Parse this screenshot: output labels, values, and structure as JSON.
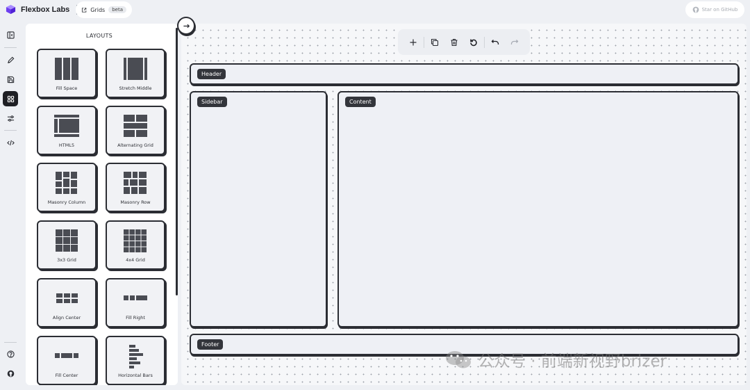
{
  "topbar": {
    "brand": "Flexbox Labs",
    "nav_label": "Grids",
    "nav_badge": "beta",
    "github_label": "Star on GitHub"
  },
  "rail": {
    "items": [
      "toggle-panel-icon",
      "pencil-icon",
      "save-icon",
      "layouts-icon",
      "sliders-icon",
      "code-icon"
    ],
    "bottom": [
      "help-icon",
      "github-icon"
    ],
    "active": "layouts-icon"
  },
  "panel": {
    "title": "LAYOUTS",
    "layouts": [
      "Fill Space",
      "Stretch Middle",
      "HTML5",
      "Alternating Grid",
      "Masonry Column",
      "Masonry Row",
      "3x3 Grid",
      "4x4 Grid",
      "Align Center",
      "Fill Right",
      "Fill Center",
      "Horizontal Bars"
    ]
  },
  "toolbar": {
    "buttons": [
      "plus-icon",
      "copy-icon",
      "trash-icon",
      "reset-icon",
      "undo-icon",
      "redo-icon"
    ]
  },
  "canvas": {
    "regions": {
      "header": "Header",
      "sidebar": "Sidebar",
      "content": "Content",
      "footer": "Footer"
    }
  },
  "watermark": "公众号 · 前端新视野brizer",
  "colors": {
    "accent_logo": "#7c4dff",
    "ink": "#2b2d33",
    "panel_bg": "#ffffff",
    "canvas_bg": "#f6f7f9"
  }
}
